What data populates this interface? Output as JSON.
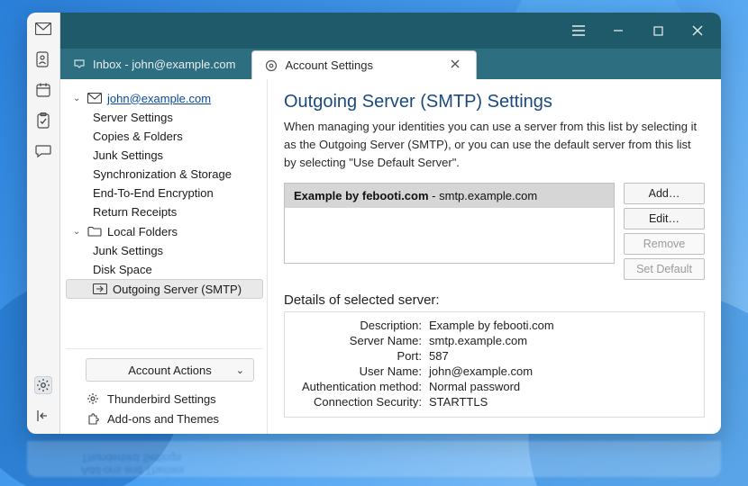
{
  "tabs": {
    "inbox": {
      "label": "Inbox - john@example.com"
    },
    "settings": {
      "label": "Account Settings"
    }
  },
  "tree": {
    "account": {
      "email": "john@example.com",
      "items": [
        "Server Settings",
        "Copies & Folders",
        "Junk Settings",
        "Synchronization & Storage",
        "End-To-End Encryption",
        "Return Receipts"
      ]
    },
    "local": {
      "label": "Local Folders",
      "items": [
        "Junk Settings",
        "Disk Space"
      ]
    },
    "smtp": {
      "label": "Outgoing Server (SMTP)"
    }
  },
  "actions": {
    "account_button": "Account Actions",
    "thunderbird": "Thunderbird Settings",
    "addons": "Add-ons and Themes"
  },
  "pane": {
    "title": "Outgoing Server (SMTP) Settings",
    "desc": "When managing your identities you can use a server from this list by selecting it as the Outgoing Server (SMTP), or you can use the default server from this list by selecting \"Use Default Server\".",
    "server_item_prefix": "Example by febooti.com",
    "server_item_sep": " - ",
    "server_item_suffix": "smtp.example.com",
    "buttons": {
      "add": "Add…",
      "edit": "Edit…",
      "remove": "Remove",
      "setdefault": "Set Default"
    },
    "details_title": "Details of selected server:",
    "details": {
      "description": {
        "label": "Description:",
        "value": "Example by febooti.com"
      },
      "server_name": {
        "label": "Server Name:",
        "value": "smtp.example.com"
      },
      "port": {
        "label": "Port:",
        "value": "587"
      },
      "user_name": {
        "label": "User Name:",
        "value": "john@example.com"
      },
      "auth": {
        "label": "Authentication method:",
        "value": "Normal password"
      },
      "security": {
        "label": "Connection Security:",
        "value": "STARTTLS"
      }
    }
  },
  "mirror": {
    "l1": "Add-ons and Themes",
    "l2": "Thunderbird Settings",
    "l3": "Connection Security:  STARTTLS"
  }
}
